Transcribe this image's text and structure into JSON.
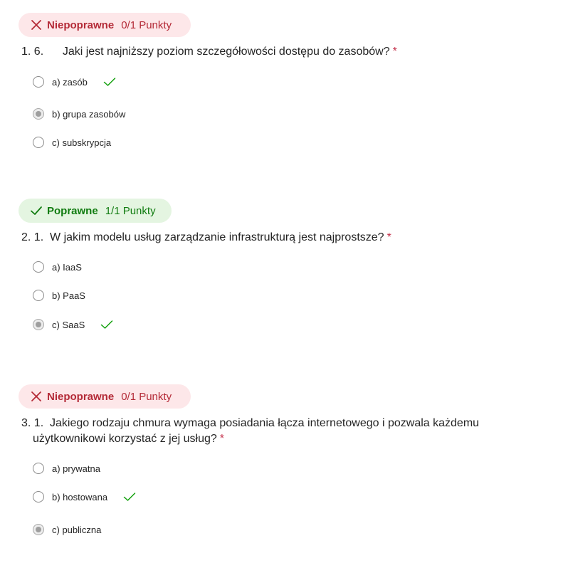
{
  "questions": [
    {
      "badge_status": "Niepoprawne",
      "badge_points": "0/1 Punkty",
      "number": "1.",
      "text": "6.      Jaki jest najniższy poziom szczegółowości dostępu do zasobów?",
      "required_mark": "*",
      "options": [
        {
          "label": "a) zasób"
        },
        {
          "label": "b) grupa zasobów"
        },
        {
          "label": "c) subskrypcja"
        }
      ]
    },
    {
      "badge_status": "Poprawne",
      "badge_points": "1/1 Punkty",
      "number": "2.",
      "text": "1.  W jakim modelu usług zarządzanie infrastrukturą jest najprostsze?",
      "required_mark": "*",
      "options": [
        {
          "label": "a) IaaS"
        },
        {
          "label": "b) PaaS"
        },
        {
          "label": "c) SaaS"
        }
      ]
    },
    {
      "badge_status": "Niepoprawne",
      "badge_points": "0/1 Punkty",
      "number": "3.",
      "text_line1": "1.  Jakiego rodzaju chmura wymaga posiadania łącza internetowego i pozwala każdemu",
      "text_line2": "użytkownikowi korzystać z jej usług?",
      "required_mark": "*",
      "options": [
        {
          "label": "a) prywatna"
        },
        {
          "label": "b) hostowana"
        },
        {
          "label": "c) publiczna"
        }
      ]
    }
  ],
  "colors": {
    "incorrect_bg": "#fde7e9",
    "incorrect_text": "#b42a37",
    "correct_bg": "#e4f5e1",
    "correct_text": "#107c10",
    "required": "#c4314b",
    "checkmark": "#13a10e"
  },
  "icons": {
    "incorrect": "close-icon",
    "correct": "checkmark-icon",
    "correct_answer_marker": "checkmark-icon"
  },
  "selected": {
    "q1": "b) grupa zasobów",
    "q2": "c) SaaS",
    "q3": "c) publiczna"
  },
  "correct_answers": {
    "q1": "a) zasób",
    "q2": "c) SaaS",
    "q3": "b) hostowana"
  }
}
